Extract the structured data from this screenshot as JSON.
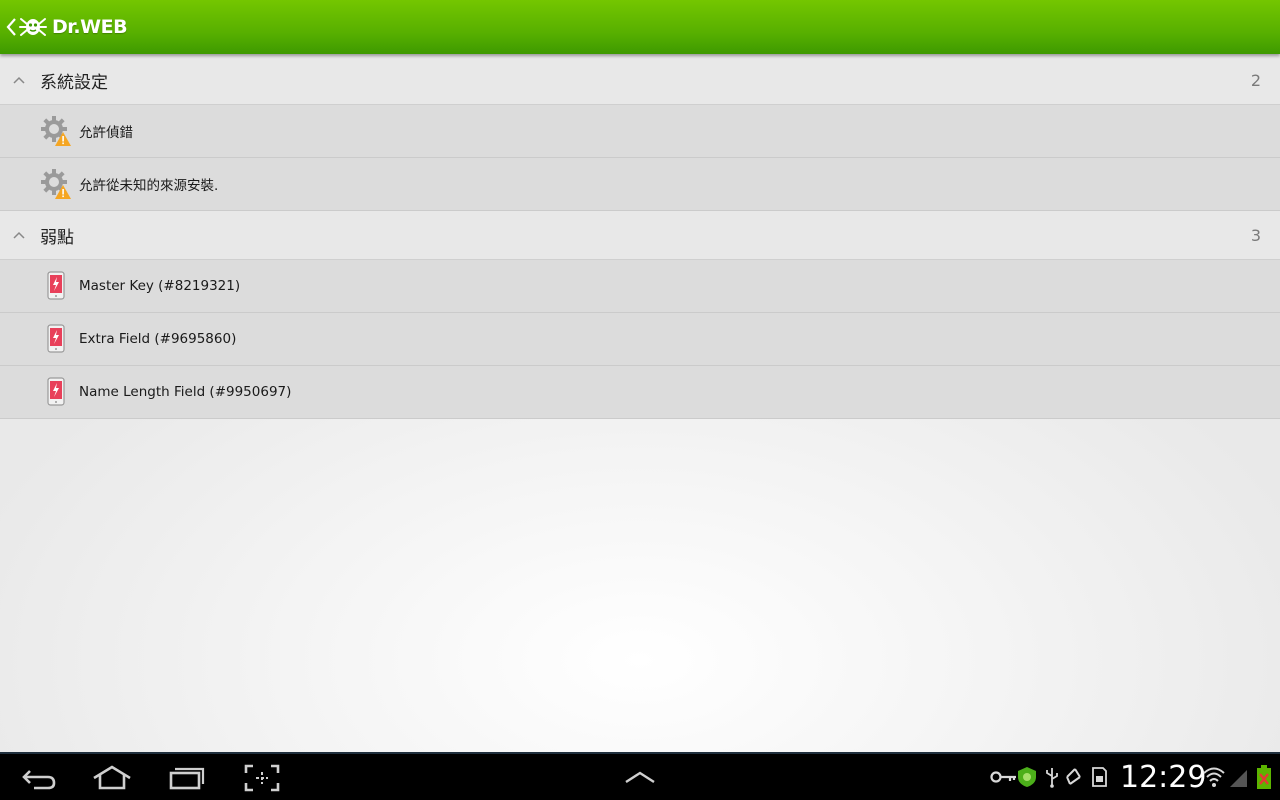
{
  "app": {
    "title": "Dr.WEB"
  },
  "groups": [
    {
      "title": "系統設定",
      "count": "2",
      "items": [
        {
          "label": "允許偵錯",
          "icon": "gear-warning-icon"
        },
        {
          "label": "允許從未知的來源安裝.",
          "icon": "gear-warning-icon"
        }
      ]
    },
    {
      "title": "弱點",
      "count": "3",
      "items": [
        {
          "label": "Master Key (#8219321)",
          "icon": "phone-vulnerability-icon"
        },
        {
          "label": "Extra Field (#9695860)",
          "icon": "phone-vulnerability-icon"
        },
        {
          "label": "Name Length Field (#9950697)",
          "icon": "phone-vulnerability-icon"
        }
      ]
    }
  ],
  "statusbar": {
    "time": "12:29"
  },
  "colors": {
    "appbar": "#5cb400",
    "warning": "#f5a623",
    "vuln": "#e8405a"
  }
}
